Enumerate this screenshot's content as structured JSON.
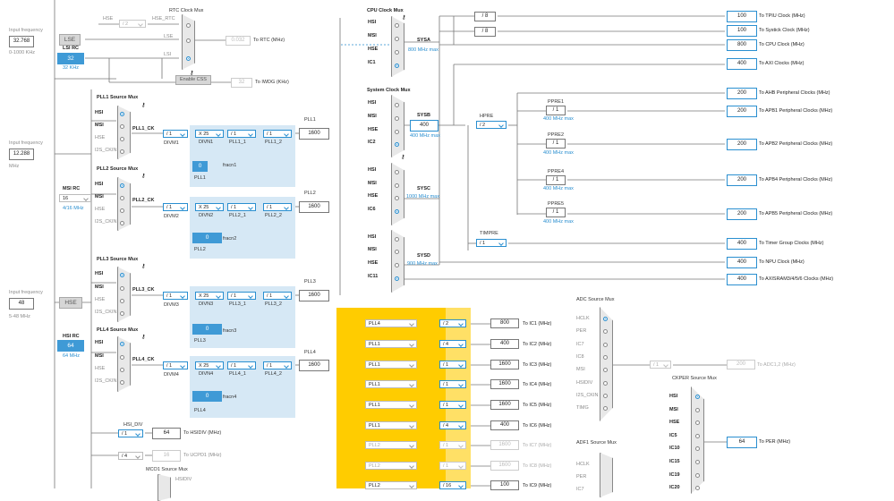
{
  "left_inputs": {
    "in1": {
      "label": "Input frequency",
      "value": "32.768",
      "range": "0-1000 KHz"
    },
    "lse": "LSE",
    "lsi": {
      "label": "LSI RC",
      "value": "32",
      "unit": "32 KHz"
    },
    "in2": {
      "label": "Input frequency",
      "value": "12.288",
      "unit": "MHz"
    },
    "msi": {
      "label": "MSI RC",
      "value": "16",
      "unit": "4/16 MHz"
    },
    "in3": {
      "label": "Input frequency",
      "value": "48",
      "range": "5-48 MHz"
    },
    "hse": "HSE",
    "hsi": {
      "label": "HSI RC",
      "value": "64",
      "unit": "64 MHz"
    }
  },
  "rtc": {
    "title": "RTC Clock Mux",
    "hse_label": "HSE",
    "div": "/ 2",
    "hse_rtc": "HSE_RTC",
    "lse": "LSE",
    "lsi": "LSI",
    "rtc_value": "0.032",
    "rtc_label": "To RTC (MHz)",
    "css": "Enable CSS",
    "iwdg_value": "32",
    "iwdg_label": "To IWDG (KHz)"
  },
  "src_labels": {
    "hsi": "HSI",
    "msi": "MSI",
    "hse": "HSE",
    "i2s": "I2S_CKIN",
    "ic1": "IC1",
    "ic2": "IC2",
    "ic6": "IC6",
    "ic11": "IC11"
  },
  "pll1": {
    "mux": "PLL1 Source Mux",
    "ck": "PLL1_CK",
    "divm": "/ 1",
    "divm_l": "DIVM1",
    "divn": "X 25",
    "divn_l": "DIVN1",
    "pll_1": "/ 1",
    "pll_1_l": "PLL1_1",
    "pll_2": "/ 1",
    "pll_2_l": "PLL1_2",
    "out_l": "PLL1",
    "out": "1600",
    "frac": "0",
    "frac_l": "fracn1",
    "name": "PLL1"
  },
  "pll2": {
    "mux": "PLL2 Source Mux",
    "ck": "PLL2_CK",
    "divm": "/ 1",
    "divm_l": "DIVM2",
    "divn": "X 25",
    "divn_l": "DIVN2",
    "pll_1": "/ 1",
    "pll_1_l": "PLL2_1",
    "pll_2": "/ 1",
    "pll_2_l": "PLL2_2",
    "out_l": "PLL2",
    "out": "1600",
    "frac": "0",
    "frac_l": "fracn2",
    "name": "PLL2"
  },
  "pll3": {
    "mux": "PLL3 Source Mux",
    "ck": "PLL3_CK",
    "divm": "/ 1",
    "divm_l": "DIVM3",
    "divn": "X 25",
    "divn_l": "DIVN3",
    "pll_1": "/ 1",
    "pll_1_l": "PLL3_1",
    "pll_2": "/ 1",
    "pll_2_l": "PLL3_2",
    "out_l": "PLL3",
    "out": "1600",
    "frac": "0",
    "frac_l": "fracn3",
    "name": "PLL3"
  },
  "pll4": {
    "mux": "PLL4 Source Mux",
    "ck": "PLL4_CK",
    "divm": "/ 1",
    "divm_l": "DIVM4",
    "divn": "X 25",
    "divn_l": "DIVN4",
    "pll_1": "/ 1",
    "pll_1_l": "PLL4_1",
    "pll_2": "/ 1",
    "pll_2_l": "PLL4_2",
    "out_l": "PLL4",
    "out": "1600",
    "frac": "0",
    "frac_l": "fracn4",
    "name": "PLL4"
  },
  "hsi_div": {
    "label": "HSI_DIV",
    "div": "/ 1",
    "value": "64",
    "out": "To HSIDIV (MHz)"
  },
  "ucpd": {
    "div": "/ 4",
    "value": "16",
    "out": "To UCPD1 (MHz)"
  },
  "mco1": {
    "title": "MCO1 Source Mux",
    "hsidiv": "HSIDIV"
  },
  "cpu": {
    "title": "CPU Clock Mux",
    "sysa": "SYSA",
    "sysa_max": "800 MHz max"
  },
  "sys": {
    "title": "System Clock Mux",
    "sysb": "SYSB",
    "sysb_val": "400",
    "sysb_max": "400 MHz max",
    "sysc": "SYSC",
    "sysc_max": "1000 MHz max",
    "sysd": "SYSD",
    "sysd_max": "900 MHz max"
  },
  "hpre": {
    "label": "HPRE",
    "div": "/ 2"
  },
  "timpre": {
    "label": "TIMPRE",
    "div": "/ 1"
  },
  "ppre": [
    {
      "label": "PPRE1",
      "div": "/ 1",
      "max": "400 MHz max"
    },
    {
      "label": "PPRE2",
      "div": "/ 1",
      "max": "400 MHz max"
    },
    {
      "label": "PPRE4",
      "div": "/ 1",
      "max": "400 MHz max"
    },
    {
      "label": "PPRE5",
      "div": "/ 1",
      "max": "400 MHz max"
    }
  ],
  "cpu_outs": [
    {
      "div": "/ 8",
      "value": "100",
      "label": "To TPIU Clock (MHz)"
    },
    {
      "div": "/ 8",
      "value": "100",
      "label": "To Systick Clock (MHz)"
    },
    {
      "value": "800",
      "label": "To CPU Clock (MHz)"
    },
    {
      "value": "400",
      "label": "To AXI Clocks (MHz)"
    }
  ],
  "sys_outs": [
    {
      "value": "200",
      "label": "To AHB Peripheral Clocks (MHz)"
    },
    {
      "value": "200",
      "label": "To APB1 Peripheral Clocks (MHz)"
    },
    {
      "value": "200",
      "label": "To APB2 Peripheral Clocks (MHz)"
    },
    {
      "value": "200",
      "label": "To APB4 Peripheral Clocks (MHz)"
    },
    {
      "value": "200",
      "label": "To APB5 Peripheral Clocks (MHz)"
    },
    {
      "value": "400",
      "label": "To Timer Group Clocks (MHz)"
    },
    {
      "value": "400",
      "label": "To NPU Clock (MHz)"
    },
    {
      "value": "400",
      "label": "To AXISRAM3/4/5/6 Clocks (MHz)"
    }
  ],
  "ic_rows": [
    {
      "src": "PLL4",
      "div": "/ 2",
      "value": "800",
      "label": "To IC1 (MHz)",
      "enabled": true
    },
    {
      "src": "PLL1",
      "div": "/ 4",
      "value": "400",
      "label": "To IC2 (MHz)",
      "enabled": true
    },
    {
      "src": "PLL1",
      "div": "/ 1",
      "value": "1600",
      "label": "To IC3 (MHz)",
      "enabled": true
    },
    {
      "src": "PLL1",
      "div": "/ 1",
      "value": "1600",
      "label": "To IC4 (MHz)",
      "enabled": true
    },
    {
      "src": "PLL1",
      "div": "/ 1",
      "value": "1600",
      "label": "To IC5 (MHz)",
      "enabled": true
    },
    {
      "src": "PLL1",
      "div": "/ 4",
      "value": "400",
      "label": "To IC6 (MHz)",
      "enabled": true
    },
    {
      "src": "PLL2",
      "div": "/ 1",
      "value": "1600",
      "label": "To IC7 (MHz)",
      "enabled": false
    },
    {
      "src": "PLL2",
      "div": "/ 1",
      "value": "1600",
      "label": "To IC8 (MHz)",
      "enabled": false
    },
    {
      "src": "PLL2",
      "div": "/ 16",
      "value": "100",
      "label": "To IC9 (MHz)",
      "enabled": true
    }
  ],
  "adc": {
    "title": "ADC Source Mux",
    "inputs": [
      "HCLK",
      "PER",
      "IC7",
      "IC8",
      "MSI",
      "HSIDIV",
      "I2S_CKIN",
      "TIMG"
    ],
    "div": "/ 1",
    "value": "200",
    "out": "To ADC1,2 (MHz)"
  },
  "adf": {
    "title": "ADF1 Source Mux",
    "inputs": [
      "HCLK",
      "PER",
      "IC7"
    ]
  },
  "ckper": {
    "title": "CKPER Source Mux",
    "inputs": [
      "HSI",
      "MSI",
      "HSE",
      "IC5",
      "IC10",
      "IC15",
      "IC19",
      "IC20"
    ],
    "value": "64",
    "out": "To PER (MHz)"
  },
  "colors": {
    "accent": "#2a8fd0",
    "yellow": "#ffcc00",
    "panel": "#d6e8f5",
    "mux": "#e8e8e8"
  }
}
